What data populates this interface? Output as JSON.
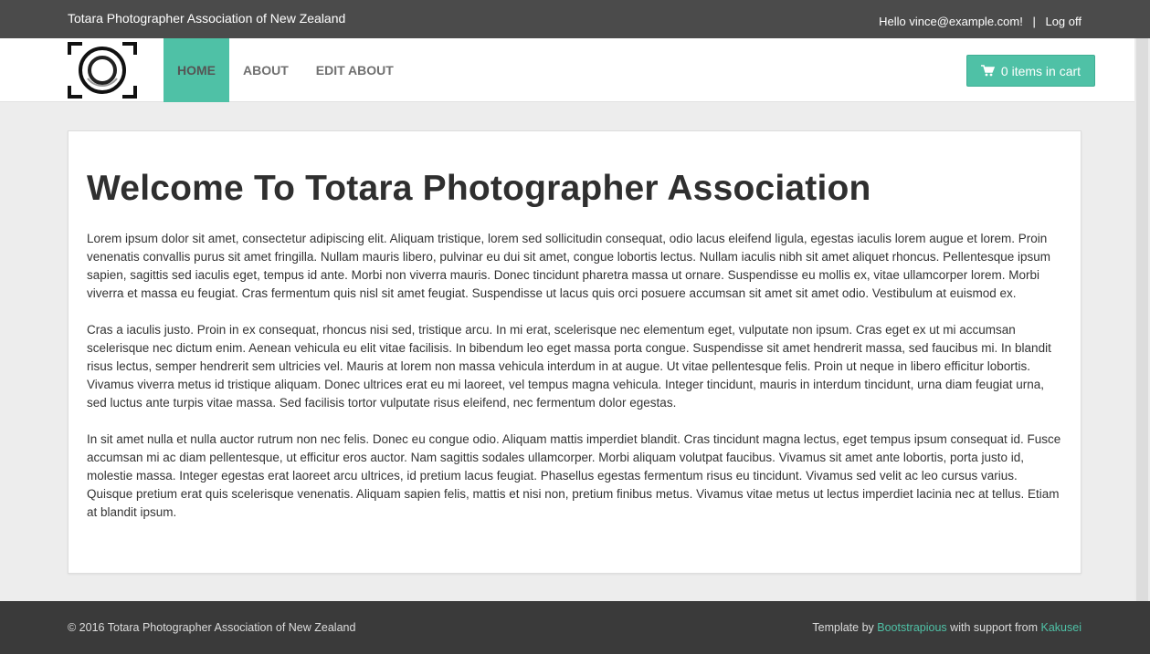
{
  "topbar": {
    "site_name": "Totara Photographer Association of New Zealand",
    "greeting": "Hello vince@example.com!",
    "separator": "|",
    "logoff_label": "Log off"
  },
  "nav": {
    "logo_icon": "camera-focus-logo",
    "items": [
      {
        "label": "HOME",
        "active": true
      },
      {
        "label": "ABOUT",
        "active": false
      },
      {
        "label": "EDIT ABOUT",
        "active": false
      }
    ],
    "cart_icon": "shopping-cart-icon",
    "cart_label": "0 items in cart"
  },
  "main": {
    "title": "Welcome To Totara Photographer Association",
    "paragraphs": [
      "Lorem ipsum dolor sit amet, consectetur adipiscing elit. Aliquam tristique, lorem sed sollicitudin consequat, odio lacus eleifend ligula, egestas iaculis lorem augue et lorem. Proin venenatis convallis purus sit amet fringilla. Nullam mauris libero, pulvinar eu dui sit amet, congue lobortis lectus. Nullam iaculis nibh sit amet aliquet rhoncus. Pellentesque ipsum sapien, sagittis sed iaculis eget, tempus id ante. Morbi non viverra mauris. Donec tincidunt pharetra massa ut ornare. Suspendisse eu mollis ex, vitae ullamcorper lorem. Morbi viverra et massa eu feugiat. Cras fermentum quis nisl sit amet feugiat. Suspendisse ut lacus quis orci posuere accumsan sit amet sit amet odio. Vestibulum at euismod ex.",
      "Cras a iaculis justo. Proin in ex consequat, rhoncus nisi sed, tristique arcu. In mi erat, scelerisque nec elementum eget, vulputate non ipsum. Cras eget ex ut mi accumsan scelerisque nec dictum enim. Aenean vehicula eu elit vitae facilisis. In bibendum leo eget massa porta congue. Suspendisse sit amet hendrerit massa, sed faucibus mi. In blandit risus lectus, semper hendrerit sem ultricies vel. Mauris at lorem non massa vehicula interdum in at augue. Ut vitae pellentesque felis. Proin ut neque in libero efficitur lobortis. Vivamus viverra metus id tristique aliquam. Donec ultrices erat eu mi laoreet, vel tempus magna vehicula. Integer tincidunt, mauris in interdum tincidunt, urna diam feugiat urna, sed luctus ante turpis vitae massa. Sed facilisis tortor vulputate risus eleifend, nec fermentum dolor egestas.",
      "In sit amet nulla et nulla auctor rutrum non nec felis. Donec eu congue odio. Aliquam mattis imperdiet blandit. Cras tincidunt magna lectus, eget tempus ipsum consequat id. Fusce accumsan mi ac diam pellentesque, ut efficitur eros auctor. Nam sagittis sodales ullamcorper. Morbi aliquam volutpat faucibus. Vivamus sit amet ante lobortis, porta justo id, molestie massa. Integer egestas erat laoreet arcu ultrices, id pretium lacus feugiat. Phasellus egestas fermentum risus eu tincidunt. Vivamus sed velit ac leo cursus varius. Quisque pretium erat quis scelerisque venenatis. Aliquam sapien felis, mattis et nisi non, pretium finibus metus. Vivamus vitae metus ut lectus imperdiet lacinia nec at tellus. Etiam at blandit ipsum."
    ]
  },
  "footer": {
    "copyright": "© 2016 Totara Photographer Association of New Zealand",
    "template_prefix": "Template by ",
    "template_link": "Bootstrapious",
    "support_text": " with support from ",
    "support_link": "Kakusei"
  },
  "colors": {
    "accent": "#4fc1a6",
    "topbar": "#4b4b4b",
    "footer": "#3a3a3a",
    "background": "#ededed"
  }
}
